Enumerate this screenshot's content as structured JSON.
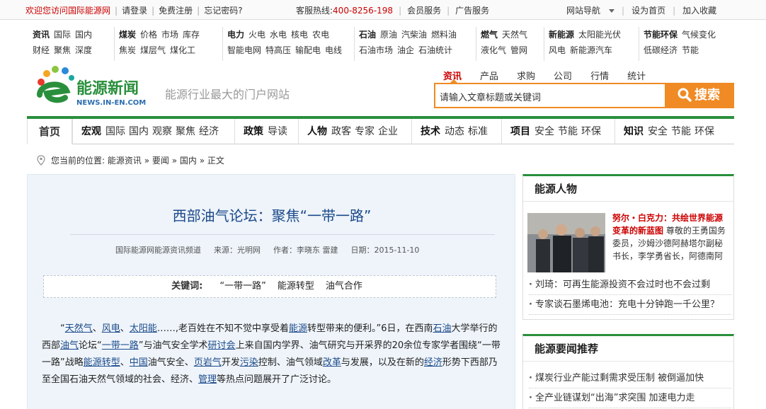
{
  "topbar": {
    "welcome": "欢迎您访问国际能源网",
    "login": "请登录",
    "register": "免费注册",
    "forgot": "忘记密码?",
    "hotline_label": "客服热线:",
    "hotline": "400-8256-198",
    "member": "会员服务",
    "ads": "广告服务",
    "sitenav": "网站导航",
    "homepage": "设为首页",
    "favorite": "加入收藏"
  },
  "catnav": [
    {
      "head": "资讯",
      "row1": [
        "国际",
        "国内"
      ],
      "row2": [
        "财经",
        "聚焦",
        "深度"
      ]
    },
    {
      "head": "煤炭",
      "row1": [
        "价格",
        "市场",
        "库存"
      ],
      "row2": [
        "焦炭",
        "煤层气",
        "煤化工"
      ]
    },
    {
      "head": "电力",
      "row1": [
        "火电",
        "水电",
        "核电",
        "农电"
      ],
      "row2": [
        "智能电网",
        "特高压",
        "输配电",
        "电线"
      ]
    },
    {
      "head": "石油",
      "row1": [
        "原油",
        "汽柴油",
        "燃料油"
      ],
      "row2": [
        "石油市场",
        "油企",
        "石油统计"
      ]
    },
    {
      "head": "燃气",
      "row1": [
        "天然气"
      ],
      "row2": [
        "液化气",
        "管网"
      ]
    },
    {
      "head": "新能源",
      "row1": [
        "太阳能光伏"
      ],
      "row2": [
        "风电",
        "新能源汽车"
      ]
    },
    {
      "head": "节能环保",
      "row1": [
        "气候变化"
      ],
      "row2": [
        "低碳经济",
        "节能"
      ]
    }
  ],
  "logo": {
    "name": "能源新闻",
    "domain": "NEWS.IN-EN.COM"
  },
  "slogan": "能源行业最大的门户网站",
  "search": {
    "tabs": [
      "资讯",
      "产品",
      "求购",
      "公司",
      "行情",
      "统计"
    ],
    "placeholder": "请输入文章标题或关键词",
    "button": "搜索"
  },
  "mainnav": {
    "home": "首页",
    "groups": [
      {
        "head": "宏观",
        "items": [
          "国际",
          "国内",
          "观察",
          "聚焦",
          "经济"
        ]
      },
      {
        "head": "政策",
        "items": [
          "导读"
        ]
      },
      {
        "head": "人物",
        "items": [
          "政客",
          "专家",
          "企业"
        ]
      },
      {
        "head": "技术",
        "items": [
          "动态",
          "标准"
        ]
      },
      {
        "head": "项目",
        "items": [
          "安全",
          "节能",
          "环保"
        ]
      },
      {
        "head": "知识",
        "items": [
          "安全",
          "节能",
          "环保"
        ]
      }
    ]
  },
  "breadcrumb": {
    "label": "您当前的位置:",
    "items": [
      "能源资讯",
      "要闻",
      "国内",
      "正文"
    ]
  },
  "article": {
    "title": "西部油气论坛：聚焦“一带一路”",
    "channel": "国际能源网能源资讯频道",
    "source": "来源：光明网",
    "author": "作者：李晓东 雷建",
    "date": "日期：2015-11-10",
    "keywords_label": "关键词:",
    "keywords": [
      "“一带一路”",
      "能源转型",
      "油气合作"
    ],
    "body_segments": [
      [
        "“",
        ""
      ],
      [
        "天然气",
        "k"
      ],
      [
        "、",
        ""
      ],
      [
        "风电",
        "k"
      ],
      [
        "、",
        ""
      ],
      [
        "太阳能",
        "k"
      ],
      [
        "……,老百姓在不知不觉中享受着",
        ""
      ],
      [
        "能源",
        "k"
      ],
      [
        "转型带来的便利。”6日，在西南",
        ""
      ],
      [
        "石油",
        "k"
      ],
      [
        "大学举行的西部",
        ""
      ],
      [
        "油气",
        "k"
      ],
      [
        "论坛“",
        ""
      ],
      [
        "一带一路",
        "k"
      ],
      [
        "”与油气安全学术",
        ""
      ],
      [
        "研讨会",
        "k"
      ],
      [
        "上来自国内学界、油气研究与开采界的20余位专家学者围绕“一带一路”战略",
        ""
      ],
      [
        "能源转型",
        "k"
      ],
      [
        "、",
        ""
      ],
      [
        "中国",
        "k"
      ],
      [
        "油气安全、",
        ""
      ],
      [
        "页岩气",
        "k"
      ],
      [
        "开发",
        ""
      ],
      [
        "污染",
        "k"
      ],
      [
        "控制、油气领域",
        ""
      ],
      [
        "改革",
        "k"
      ],
      [
        "与发展，以及在新的",
        ""
      ],
      [
        "经济",
        "k"
      ],
      [
        "形势下西部乃至全国石油天然气领域的社会、经济、",
        ""
      ],
      [
        "管理",
        "k"
      ],
      [
        "等热点问题展开了广泛讨论。",
        ""
      ]
    ]
  },
  "sidebar": {
    "people": {
      "title": "能源人物",
      "feature_title": "努尔・白克力：共绘世界能源变革的新蓝图",
      "feature_desc": "尊敬的王勇国务委员，沙姆沙德阿赫塔尔副秘书长，李学勇省长，阿德南阿",
      "items": [
        "刘琦：可再生能源投资不会过时也不会过剩",
        "专家谈石墨烯电池：充电十分钟跑一千公里？"
      ]
    },
    "news": {
      "title": "能源要闻推荐",
      "items": [
        "煤炭行业产能过剩需求受压制 被倒逼加快",
        "全产业链谋划“出海”求突围 加速电力走"
      ]
    }
  },
  "colors": {
    "accent": "#2a8f3c",
    "search": "#f08a24",
    "title": "#1c4a8a",
    "red": "#c00"
  }
}
